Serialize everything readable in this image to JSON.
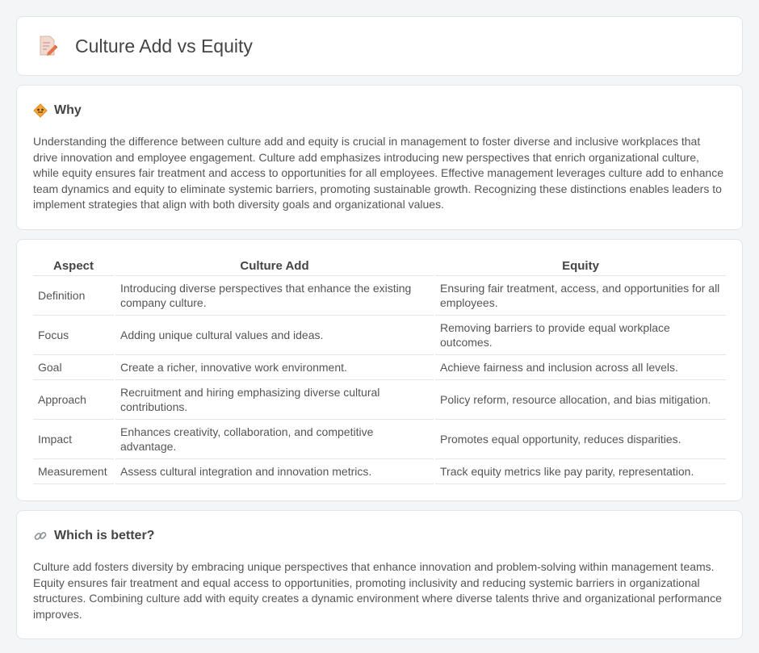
{
  "header": {
    "title": "Culture Add vs Equity"
  },
  "why": {
    "heading": "Why",
    "text": "Understanding the difference between culture add and equity is crucial in management to foster diverse and inclusive workplaces that drive innovation and employee engagement. Culture add emphasizes introducing new perspectives that enrich organizational culture, while equity ensures fair treatment and access to opportunities for all employees. Effective management leverages culture add to enhance team dynamics and equity to eliminate systemic barriers, promoting sustainable growth. Recognizing these distinctions enables leaders to implement strategies that align with both diversity goals and organizational values."
  },
  "table": {
    "headers": [
      "Aspect",
      "Culture Add",
      "Equity"
    ],
    "rows": [
      [
        "Definition",
        "Introducing diverse perspectives that enhance the existing company culture.",
        "Ensuring fair treatment, access, and opportunities for all employees."
      ],
      [
        "Focus",
        "Adding unique cultural values and ideas.",
        "Removing barriers to provide equal workplace outcomes."
      ],
      [
        "Goal",
        "Create a richer, innovative work environment.",
        "Achieve fairness and inclusion across all levels."
      ],
      [
        "Approach",
        "Recruitment and hiring emphasizing diverse cultural contributions.",
        "Policy reform, resource allocation, and bias mitigation."
      ],
      [
        "Impact",
        "Enhances creativity, collaboration, and competitive advantage.",
        "Promotes equal opportunity, reduces disparities."
      ],
      [
        "Measurement",
        "Assess cultural integration and innovation metrics.",
        "Track equity metrics like pay parity, representation."
      ]
    ]
  },
  "better": {
    "heading": "Which is better?",
    "text": "Culture add fosters diversity by embracing unique perspectives that enhance innovation and problem-solving within management teams. Equity ensures fair treatment and equal access to opportunities, promoting inclusivity and reducing systemic barriers in organizational structures. Combining culture add with equity creates a dynamic environment where diverse talents thrive and organizational performance improves."
  },
  "icons": {
    "header": "document-pencil-icon",
    "why": "warning-diamond-icon",
    "better": "link-icon"
  }
}
